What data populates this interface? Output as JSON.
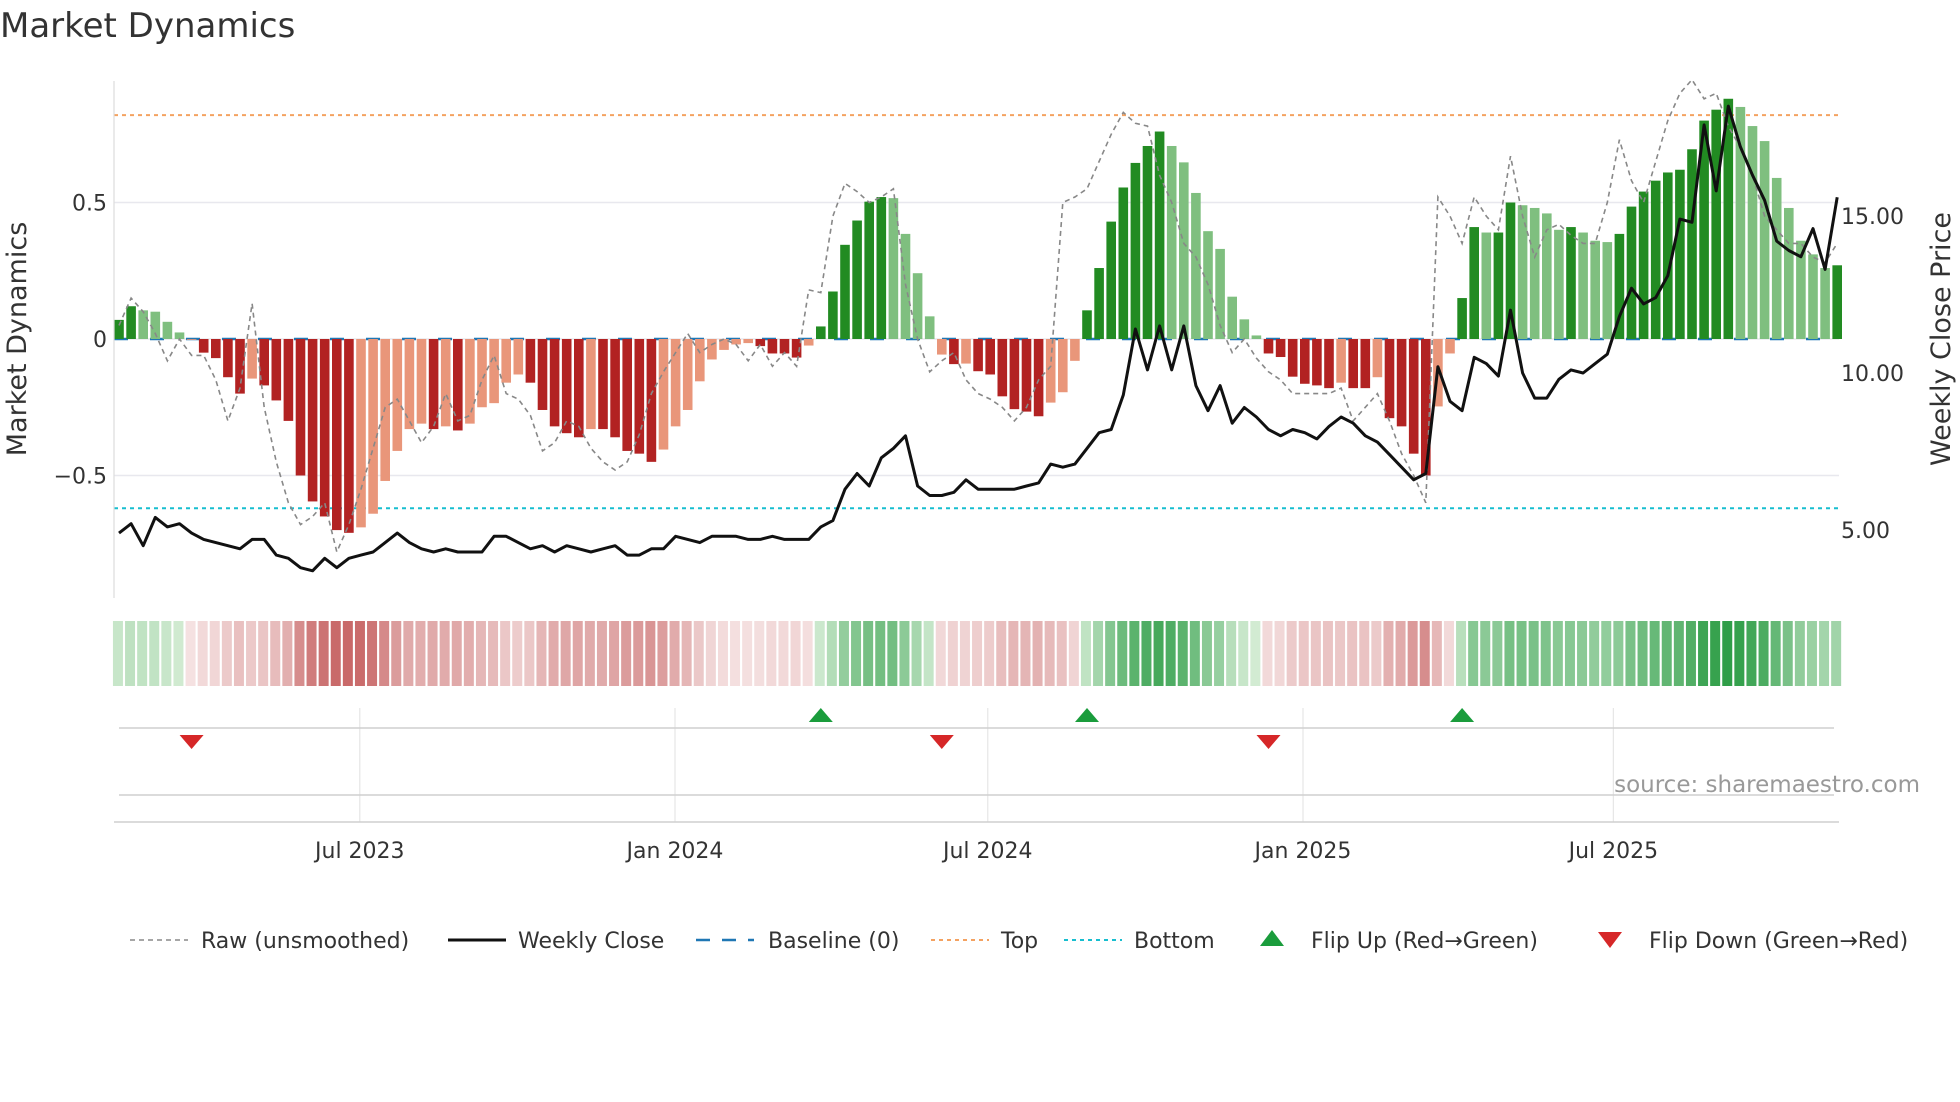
{
  "title": "Market Dynamics",
  "source": "source: sharemaestro.com",
  "colors": {
    "green_dark": "#228b22",
    "green_light": "#7fbf7f",
    "red_dark": "#b22222",
    "red_light": "#e9967a",
    "raw": "#888888",
    "close": "#111111",
    "baseline": "#1f77b4",
    "top": "#f4a261",
    "bottom": "#17becf",
    "flip_up": "#1a9c3c",
    "flip_down": "#d62728",
    "source": "#999999"
  },
  "chart_data": {
    "type": "bar",
    "title": "Market Dynamics",
    "ylabel": "Market Dynamics",
    "y2label": "Weekly Close Price",
    "ylim": [
      -0.98,
      0.95
    ],
    "y2lim": [
      1.5,
      21.5
    ],
    "yticks": [
      {
        "v": 0.5,
        "label": "0.5"
      },
      {
        "v": 0,
        "label": "0"
      },
      {
        "v": -0.5,
        "label": "−0.5"
      }
    ],
    "y2ticks": [
      {
        "v": 15,
        "label": "15.00"
      },
      {
        "v": 10,
        "label": "10.00"
      },
      {
        "v": 5,
        "label": "5.00"
      }
    ],
    "xticks": [
      {
        "week": 20.9,
        "label": "Jul 2023"
      },
      {
        "week": 46.95,
        "label": "Jan 2024"
      },
      {
        "week": 72.8,
        "label": "Jul 2024"
      },
      {
        "week": 98.85,
        "label": "Jan 2025"
      },
      {
        "week": 124.5,
        "label": "Jul 2025"
      }
    ],
    "top_level": 0.82,
    "bottom_level": -0.62,
    "baseline": 0,
    "smoothed": [
      0.07,
      0.12,
      0.105,
      0.1,
      0.063,
      0.024,
      -0.003,
      -0.05,
      -0.07,
      -0.14,
      -0.2,
      -0.145,
      -0.17,
      -0.225,
      -0.3,
      -0.5,
      -0.595,
      -0.65,
      -0.7,
      -0.71,
      -0.69,
      -0.64,
      -0.52,
      -0.41,
      -0.33,
      -0.31,
      -0.33,
      -0.32,
      -0.335,
      -0.31,
      -0.25,
      -0.235,
      -0.16,
      -0.13,
      -0.16,
      -0.26,
      -0.32,
      -0.345,
      -0.36,
      -0.33,
      -0.33,
      -0.36,
      -0.41,
      -0.42,
      -0.45,
      -0.405,
      -0.32,
      -0.26,
      -0.155,
      -0.075,
      -0.04,
      -0.02,
      -0.015,
      -0.026,
      -0.053,
      -0.053,
      -0.068,
      -0.024,
      0.046,
      0.174,
      0.345,
      0.434,
      0.503,
      0.52,
      0.516,
      0.385,
      0.241,
      0.083,
      -0.057,
      -0.092,
      -0.09,
      -0.118,
      -0.13,
      -0.21,
      -0.257,
      -0.266,
      -0.283,
      -0.233,
      -0.195,
      -0.08,
      0.105,
      0.26,
      0.43,
      0.555,
      0.645,
      0.707,
      0.76,
      0.707,
      0.647,
      0.535,
      0.395,
      0.33,
      0.155,
      0.072,
      0.013,
      -0.053,
      -0.066,
      -0.138,
      -0.164,
      -0.17,
      -0.18,
      -0.16,
      -0.18,
      -0.18,
      -0.14,
      -0.29,
      -0.32,
      -0.42,
      -0.5,
      -0.247,
      -0.053,
      0.15,
      0.41,
      0.39,
      0.39,
      0.5,
      0.49,
      0.48,
      0.46,
      0.4,
      0.41,
      0.39,
      0.36,
      0.355,
      0.385,
      0.485,
      0.54,
      0.58,
      0.61,
      0.62,
      0.695,
      0.8,
      0.84,
      0.88,
      0.85,
      0.78,
      0.725,
      0.59,
      0.48,
      0.36,
      0.31,
      0.26,
      0.27
    ],
    "raw": [
      0.05,
      0.15,
      0.1,
      0.02,
      -0.08,
      0.0,
      -0.06,
      -0.06,
      -0.15,
      -0.3,
      -0.18,
      0.13,
      -0.25,
      -0.45,
      -0.6,
      -0.68,
      -0.65,
      -0.6,
      -0.78,
      -0.68,
      -0.55,
      -0.4,
      -0.25,
      -0.22,
      -0.3,
      -0.38,
      -0.32,
      -0.2,
      -0.3,
      -0.28,
      -0.15,
      -0.06,
      -0.2,
      -0.22,
      -0.28,
      -0.41,
      -0.38,
      -0.3,
      -0.32,
      -0.4,
      -0.45,
      -0.48,
      -0.45,
      -0.35,
      -0.2,
      -0.12,
      -0.05,
      0.02,
      -0.05,
      -0.02,
      0.0,
      -0.02,
      -0.08,
      -0.02,
      -0.1,
      -0.05,
      -0.1,
      0.18,
      0.17,
      0.45,
      0.57,
      0.54,
      0.5,
      0.52,
      0.55,
      0.2,
      0.0,
      -0.12,
      -0.08,
      -0.05,
      -0.15,
      -0.2,
      -0.22,
      -0.25,
      -0.3,
      -0.25,
      -0.15,
      -0.1,
      0.5,
      0.52,
      0.55,
      0.65,
      0.75,
      0.83,
      0.79,
      0.78,
      0.6,
      0.5,
      0.35,
      0.3,
      0.2,
      0.05,
      -0.05,
      0.0,
      -0.07,
      -0.12,
      -0.15,
      -0.2,
      -0.2,
      -0.2,
      -0.2,
      -0.18,
      -0.3,
      -0.25,
      -0.2,
      -0.3,
      -0.42,
      -0.5,
      -0.6,
      0.52,
      0.45,
      0.35,
      0.52,
      0.45,
      0.4,
      0.67,
      0.45,
      0.3,
      0.4,
      0.42,
      0.38,
      0.35,
      0.35,
      0.5,
      0.73,
      0.58,
      0.5,
      0.65,
      0.8,
      0.9,
      0.95,
      0.88,
      0.9,
      0.78,
      0.7,
      0.6,
      0.45,
      0.4,
      0.35,
      0.35,
      0.3,
      0.28,
      0.35
    ],
    "close": [
      4.9,
      5.2,
      4.5,
      5.4,
      5.1,
      5.2,
      4.9,
      4.7,
      4.6,
      4.5,
      4.4,
      4.7,
      4.7,
      4.2,
      4.1,
      3.8,
      3.7,
      4.1,
      3.8,
      4.1,
      4.2,
      4.3,
      4.6,
      4.9,
      4.6,
      4.4,
      4.3,
      4.4,
      4.3,
      4.3,
      4.3,
      4.8,
      4.8,
      4.6,
      4.4,
      4.5,
      4.3,
      4.5,
      4.4,
      4.3,
      4.4,
      4.5,
      4.2,
      4.2,
      4.4,
      4.4,
      4.8,
      4.7,
      4.6,
      4.8,
      4.8,
      4.8,
      4.7,
      4.7,
      4.8,
      4.7,
      4.7,
      4.7,
      5.1,
      5.3,
      6.3,
      6.8,
      6.4,
      7.3,
      7.6,
      8.0,
      6.4,
      6.1,
      6.1,
      6.2,
      6.6,
      6.3,
      6.3,
      6.3,
      6.3,
      6.4,
      6.5,
      7.1,
      7.0,
      7.1,
      7.6,
      8.1,
      8.2,
      9.3,
      11.4,
      10.1,
      11.5,
      10.1,
      11.5,
      9.6,
      8.8,
      9.6,
      8.4,
      8.9,
      8.6,
      8.2,
      8.0,
      8.2,
      8.1,
      7.9,
      8.3,
      8.6,
      8.4,
      8.0,
      7.8,
      7.4,
      7.0,
      6.6,
      6.8,
      10.2,
      9.1,
      8.8,
      10.5,
      10.3,
      9.9,
      12.0,
      10.0,
      9.2,
      9.2,
      9.8,
      10.1,
      10.0,
      10.3,
      10.6,
      11.8,
      12.7,
      12.2,
      12.4,
      13.1,
      14.9,
      14.8,
      17.9,
      15.8,
      18.5,
      17.2,
      16.3,
      15.5,
      14.2,
      13.9,
      13.7,
      14.6,
      13.3,
      15.6
    ]
  },
  "legend": [
    {
      "key": "raw",
      "label": "Raw (unsmoothed)"
    },
    {
      "key": "close",
      "label": "Weekly Close"
    },
    {
      "key": "baseline",
      "label": "Baseline (0)"
    },
    {
      "key": "top",
      "label": "Top"
    },
    {
      "key": "bottom",
      "label": "Bottom"
    },
    {
      "key": "flip_up",
      "label": "Flip Up (Red→Green)"
    },
    {
      "key": "flip_down",
      "label": "Flip Down (Green→Red)"
    }
  ]
}
